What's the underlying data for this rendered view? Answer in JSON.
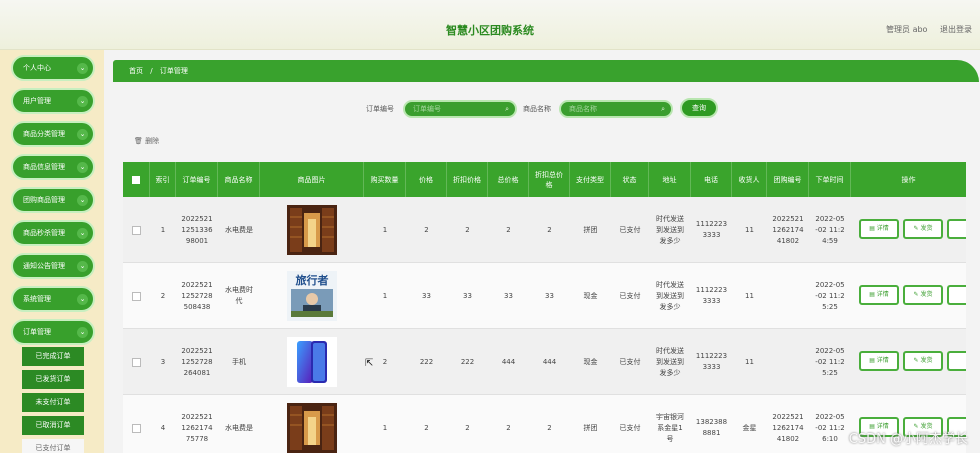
{
  "header": {
    "title": "智慧小区团购系统",
    "admin": "管理员 abo",
    "logout": "退出登录"
  },
  "sidebar": {
    "items": [
      {
        "label": "个人中心"
      },
      {
        "label": "用户管理"
      },
      {
        "label": "商品分类管理"
      },
      {
        "label": "商品信息管理"
      },
      {
        "label": "团购商品管理"
      },
      {
        "label": "商品秒杀管理"
      },
      {
        "label": "通知公告管理"
      },
      {
        "label": "系统管理"
      },
      {
        "label": "订单管理"
      }
    ],
    "subitems": [
      {
        "label": "已完成订单"
      },
      {
        "label": "已发货订单"
      },
      {
        "label": "未支付订单"
      },
      {
        "label": "已取消订单"
      },
      {
        "label": "已支付订单"
      }
    ]
  },
  "breadcrumb": {
    "home": "首页",
    "sep": "/",
    "current": "订单管理"
  },
  "search": {
    "order_label": "订单编号",
    "order_placeholder": "订单编号",
    "name_label": "商品名称",
    "name_placeholder": "商品名称",
    "query_button": "查询"
  },
  "toolbar": {
    "delete_label": "删除"
  },
  "table": {
    "headers": [
      "索引",
      "订单编号",
      "商品名称",
      "商品图片",
      "购买数量",
      "价格",
      "折扣价格",
      "总价格",
      "折扣总价格",
      "支付类型",
      "状态",
      "地址",
      "电话",
      "收货人",
      "团购编号",
      "下单时间",
      "操作"
    ],
    "rows": [
      {
        "index": "1",
        "order_no": "2022521\n1251336\n98001",
        "name": "水电费是",
        "qty": "1",
        "price": "2",
        "disc_price": "2",
        "total": "2",
        "disc_total": "2",
        "pay": "拼团",
        "status": "已支付",
        "address": "时代发送\n到发送到\n发多少",
        "phone": "1112223\n3333",
        "receiver": "11",
        "group_no": "2022521\n1262174\n41802",
        "time": "2022-05\n-02 11:2\n4:59",
        "image": "library"
      },
      {
        "index": "2",
        "order_no": "2022521\n1252728\n508438",
        "name": "水电费时\n代",
        "qty": "1",
        "price": "33",
        "disc_price": "33",
        "total": "33",
        "disc_total": "33",
        "pay": "现金",
        "status": "已支付",
        "address": "时代发送\n到发送到\n发多少",
        "phone": "1112223\n3333",
        "receiver": "11",
        "group_no": "",
        "time": "2022-05\n-02 11:2\n5:25",
        "image": "travel",
        "image_text": "旅行者"
      },
      {
        "index": "3",
        "order_no": "2022521\n1252728\n264081",
        "name": "手机",
        "qty": "2",
        "price": "222",
        "disc_price": "222",
        "total": "444",
        "disc_total": "444",
        "pay": "现金",
        "status": "已支付",
        "address": "时代发送\n到发送到\n发多少",
        "phone": "1112223\n3333",
        "receiver": "11",
        "group_no": "",
        "time": "2022-05\n-02 11:2\n5:25",
        "image": "phone"
      },
      {
        "index": "4",
        "order_no": "2022521\n1262174\n75778",
        "name": "水电费是",
        "qty": "1",
        "price": "2",
        "disc_price": "2",
        "total": "2",
        "disc_total": "2",
        "pay": "拼团",
        "status": "已支付",
        "address": "宇宙银河\n系金星1\n号",
        "phone": "1382388\n8881",
        "receiver": "金星",
        "group_no": "2022521\n1262174\n41802",
        "time": "2022-05\n-02 11:2\n6:10",
        "image": "library"
      }
    ],
    "actions": {
      "detail": "详情",
      "ship": "发货"
    }
  },
  "watermark": "CSDN @小阿杰学长",
  "colors": {
    "accent": "#39a22d",
    "sidebar_bg": "#f6ebc6",
    "title": "#2b8a20"
  }
}
